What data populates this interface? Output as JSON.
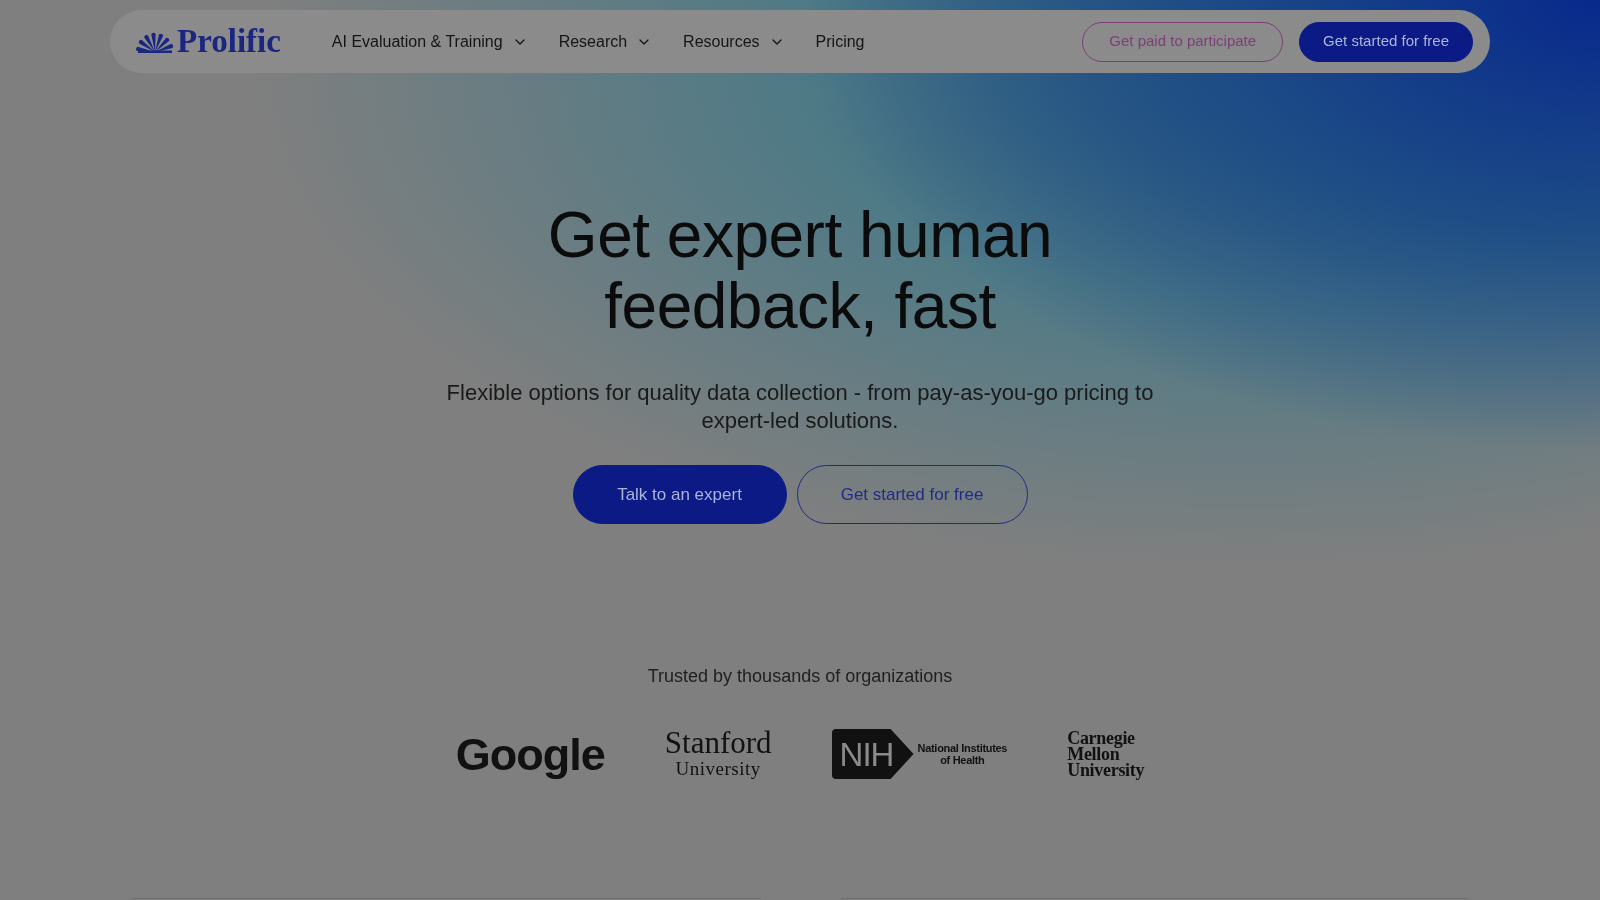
{
  "nav": {
    "logo": "Prolific",
    "items": [
      {
        "label": "AI Evaluation & Training",
        "dropdown": true
      },
      {
        "label": "Research",
        "dropdown": true
      },
      {
        "label": "Resources",
        "dropdown": true
      },
      {
        "label": "Pricing",
        "dropdown": false
      }
    ],
    "buttons": [
      {
        "label": "Get paid to participate",
        "kind": "outline"
      },
      {
        "label": "Get started for free",
        "kind": "filled"
      }
    ]
  },
  "hero": {
    "title": "Get expert human feedback, fast",
    "subtitle": "Flexible options for quality data collection - from pay-as-you-go pricing to expert-led solutions.",
    "buttons": [
      {
        "label": "Talk to an expert",
        "kind": "filled"
      },
      {
        "label": "Get started for free",
        "kind": "outline"
      }
    ]
  },
  "trusted": {
    "heading": "Trusted by thousands of organizations",
    "logos": [
      {
        "kind": "google",
        "wordmark": [
          "Google"
        ]
      },
      {
        "kind": "stanford",
        "wordmark": [
          "Stanford",
          "University"
        ]
      },
      {
        "kind": "nih",
        "badge": "NIH",
        "wordmark": [
          "National Institutes",
          "of Health"
        ]
      },
      {
        "kind": "cmu",
        "wordmark": [
          "Carnegie",
          "Mellon",
          "University"
        ]
      }
    ]
  }
}
